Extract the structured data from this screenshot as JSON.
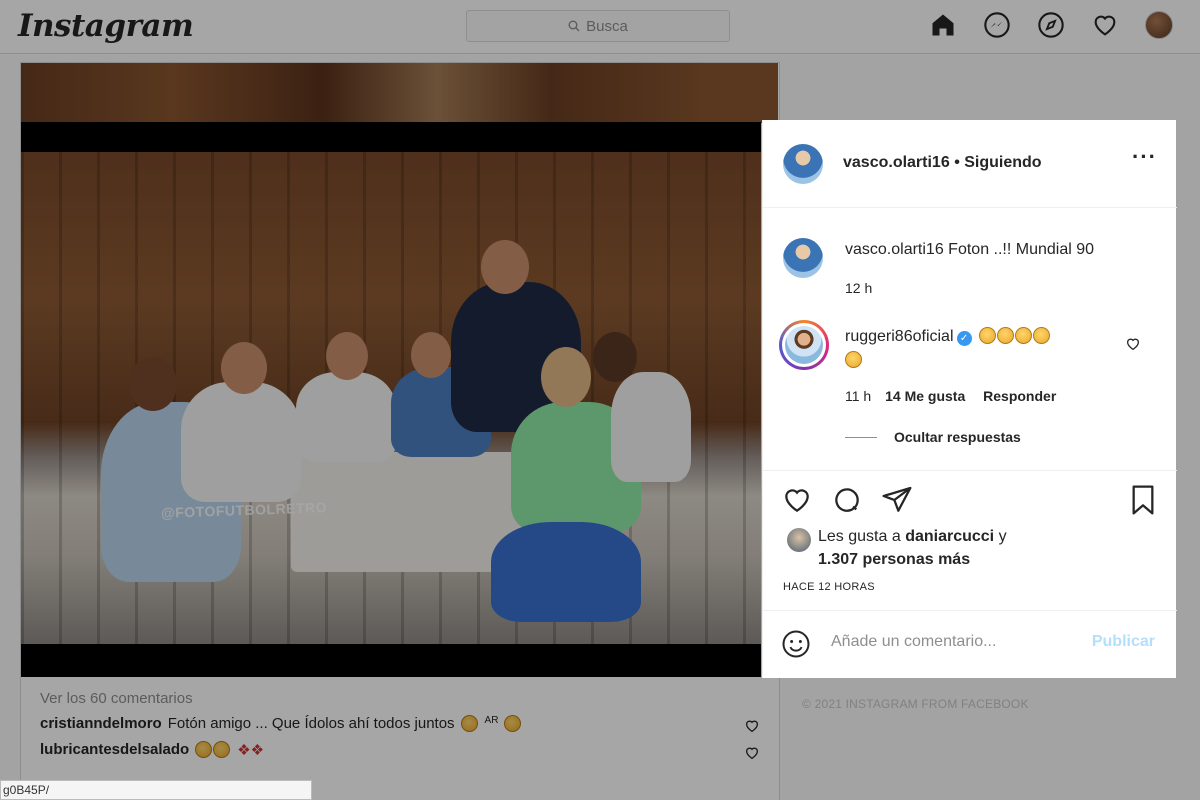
{
  "app": {
    "logo": "Instagram"
  },
  "search": {
    "placeholder": "Busca"
  },
  "nav": {
    "icons": [
      "home-icon",
      "messenger-icon",
      "explore-icon",
      "heart-icon",
      "profile-avatar"
    ]
  },
  "post": {
    "author": "vasco.olarti16",
    "follow_status": "• Siguiendo",
    "caption": "Foton ..!! Mundial 90",
    "caption_time": "12 h",
    "watermark": "@FOTOFUTBOLRETRO",
    "comments": [
      {
        "user": "ruggeri86oficial",
        "verified": true,
        "claps": 5,
        "time": "11 h",
        "likes": "14 Me gusta",
        "reply": "Responder",
        "hide_replies": "Ocultar respuestas"
      }
    ],
    "liked_by_prefix": "Les gusta a",
    "liked_by_user": "daniarcucci",
    "liked_by_suffix": "y",
    "liked_by_others": "1.307 personas más",
    "posted_ago": "HACE 12 HORAS",
    "comment_placeholder": "Añade un comentario...",
    "publish_label": "Publicar"
  },
  "feed": {
    "view_all_comments": "Ver los 60 comentarios",
    "comments": [
      {
        "user": "cristianndelmoro",
        "text": "Fotón amigo ... Que Ídolos ahí todos juntos",
        "suffix": "AR"
      },
      {
        "user": "lubricantesdelsalado",
        "text": ""
      }
    ],
    "footer": "© 2021 INSTAGRAM FROM FACEBOOK"
  },
  "status_url": "g0B45P/",
  "colors": {
    "accent_blue": "#3897f0",
    "publish_disabled": "#b2dffc",
    "overlay": "rgba(0,0,0,0.35)"
  }
}
